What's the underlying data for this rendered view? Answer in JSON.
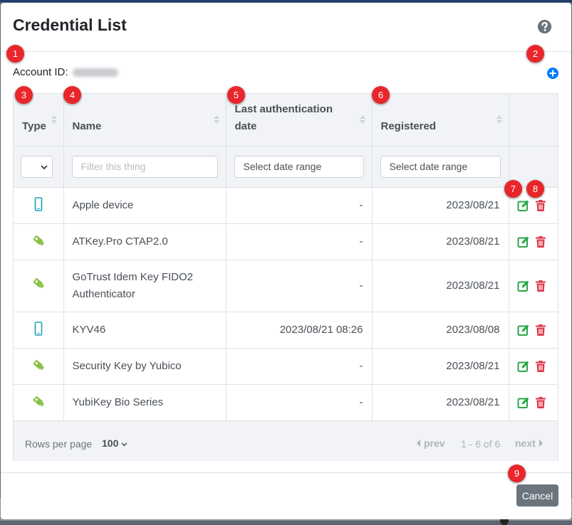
{
  "modal": {
    "title": "Credential List"
  },
  "account": {
    "label": "Account ID:"
  },
  "markers": [
    "1",
    "2",
    "3",
    "4",
    "5",
    "6",
    "7",
    "8",
    "9"
  ],
  "table": {
    "headers": {
      "type": "Type",
      "name": "Name",
      "last_auth_line1": "Last authentication",
      "last_auth_line2": "date",
      "registered": "Registered"
    },
    "filters": {
      "name_placeholder": "Filter this thing",
      "last_auth_placeholder": "Select date range",
      "registered_placeholder": "Select date range"
    },
    "rows": [
      {
        "type_icon": "mobile-icon",
        "name": "Apple device",
        "last_auth": "-",
        "registered": "2023/08/21"
      },
      {
        "type_icon": "usb-key-icon",
        "name": "ATKey.Pro CTAP2.0",
        "last_auth": "-",
        "registered": "2023/08/21"
      },
      {
        "type_icon": "usb-key-icon",
        "name_line1": "GoTrust Idem Key FIDO2",
        "name_line2": "Authenticator",
        "last_auth": "-",
        "registered": "2023/08/21"
      },
      {
        "type_icon": "mobile-icon",
        "name": "KYV46",
        "last_auth": "2023/08/21 08:26",
        "registered": "2023/08/08"
      },
      {
        "type_icon": "usb-key-icon",
        "name": "Security Key by Yubico",
        "last_auth": "-",
        "registered": "2023/08/21"
      },
      {
        "type_icon": "usb-key-icon",
        "name": "YubiKey Bio Series",
        "last_auth": "-",
        "registered": "2023/08/21"
      }
    ]
  },
  "pagination": {
    "rows_per_page_label": "Rows per page",
    "rows_per_page_value": "100",
    "prev_label": "prev",
    "range_text": "1 - 6 of 6",
    "next_label": "next"
  },
  "footer": {
    "cancel_label": "Cancel"
  },
  "colors": {
    "marker": "#e8262b",
    "edit": "#28a745",
    "delete": "#dc3545",
    "mobile_icon": "#17a2b8",
    "usb_icon": "#8bc34a",
    "add_icon": "#007bff"
  }
}
